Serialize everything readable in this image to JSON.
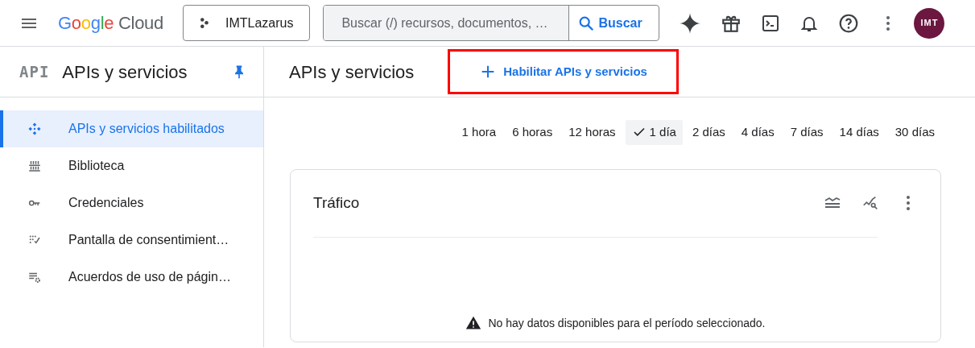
{
  "topbar": {
    "logo": "Google Cloud",
    "project": "IMTLazarus",
    "search": {
      "placeholder": "Buscar (/) recursos, documentos, …",
      "button": "Buscar"
    },
    "avatar": "IMT"
  },
  "sidebar": {
    "badge": "API",
    "title": "APIs y servicios",
    "pinned": true,
    "items": [
      {
        "label": "APIs y servicios habilitados",
        "selected": true
      },
      {
        "label": "Biblioteca",
        "selected": false
      },
      {
        "label": "Credenciales",
        "selected": false
      },
      {
        "label": "Pantalla de consentimient…",
        "selected": false
      },
      {
        "label": "Acuerdos de uso de págin…",
        "selected": false
      }
    ]
  },
  "main": {
    "title": "APIs y servicios",
    "action": {
      "label": "Habilitar APIs y servicios",
      "highlighted": true
    },
    "time_ranges": [
      {
        "label": "1 hora",
        "selected": false
      },
      {
        "label": "6 horas",
        "selected": false
      },
      {
        "label": "12 horas",
        "selected": false
      },
      {
        "label": "1 día",
        "selected": true
      },
      {
        "label": "2 días",
        "selected": false
      },
      {
        "label": "4 días",
        "selected": false
      },
      {
        "label": "7 días",
        "selected": false
      },
      {
        "label": "14 días",
        "selected": false
      },
      {
        "label": "30 días",
        "selected": false
      }
    ],
    "card": {
      "title": "Tráfico",
      "message": "No hay datos disponibles para el período seleccionado."
    }
  }
}
